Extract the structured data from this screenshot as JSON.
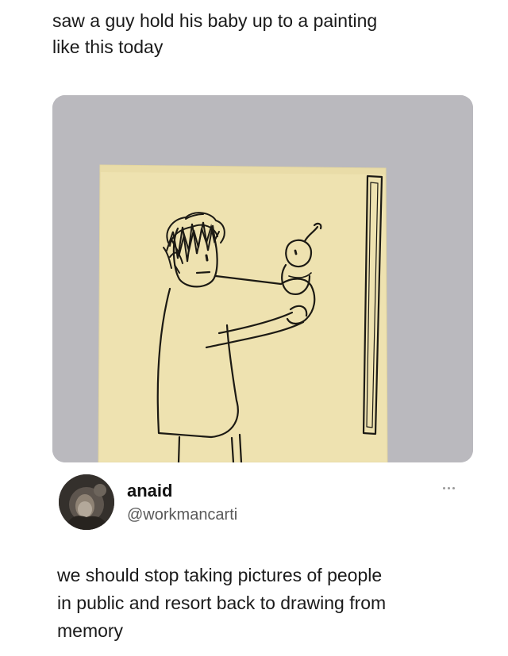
{
  "post": {
    "caption_lines": [
      "saw a guy hold his baby up to a painting",
      "like this today"
    ]
  },
  "media": {
    "icon": "sticky-note-drawing",
    "background_color": "#b9b8bd",
    "note_color": "#efe3b2"
  },
  "quoted_tweet": {
    "display_name": "anaid",
    "handle": "@workmancarti",
    "more_icon": "more-horizontal-icon",
    "body_lines": [
      "we should stop taking pictures of people",
      "in public and resort back to drawing from",
      "memory"
    ]
  }
}
